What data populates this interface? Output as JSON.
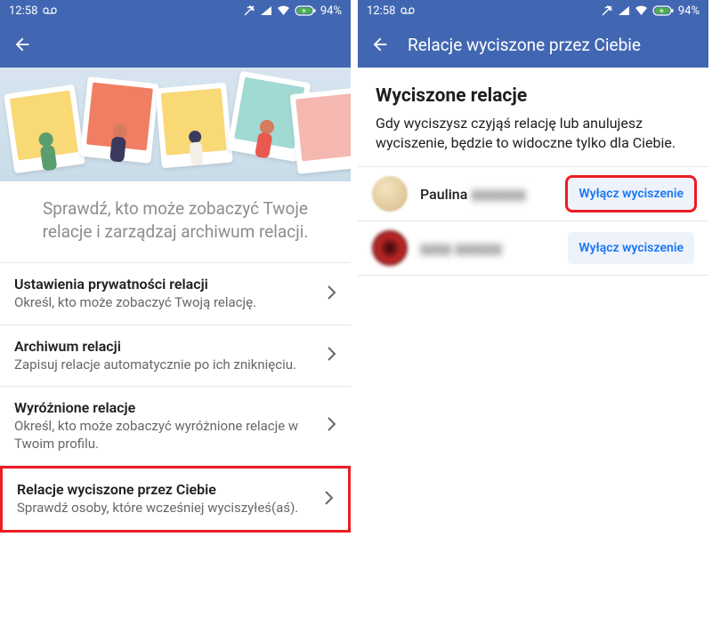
{
  "status": {
    "time": "12:58",
    "battery": "94%"
  },
  "left": {
    "intro": "Sprawdź, kto może zobaczyć Twoje relacje i zarządzaj archiwum relacji.",
    "rows": [
      {
        "title": "Ustawienia prywatności relacji",
        "desc": "Określ, kto może zobaczyć Twoją relację."
      },
      {
        "title": "Archiwum relacji",
        "desc": "Zapisuj relacje automatycznie po ich zniknięciu."
      },
      {
        "title": "Wyróżnione relacje",
        "desc": "Określ, kto może zobaczyć wyróżnione relacje w Twoim profilu."
      },
      {
        "title": "Relacje wyciszone przez Ciebie",
        "desc": "Sprawdź osoby, które wcześniej wyciszyłeś(aś)."
      }
    ]
  },
  "right": {
    "header_title": "Relacje wyciszone przez Ciebie",
    "section_title": "Wyciszone relacje",
    "section_desc": "Gdy wyciszysz czyjąś relację lub anulujesz wyciszenie, będzie to widoczne tylko dla Ciebie.",
    "users": [
      {
        "name": "Paulina",
        "obscured": "▮▮▮▮▮▮▮",
        "button": "Wyłącz wyciszenie"
      },
      {
        "name": "",
        "obscured": "▮▮▮▮ ▮▮▮▮▮▮",
        "button": "Wyłącz wyciszenie"
      }
    ]
  }
}
